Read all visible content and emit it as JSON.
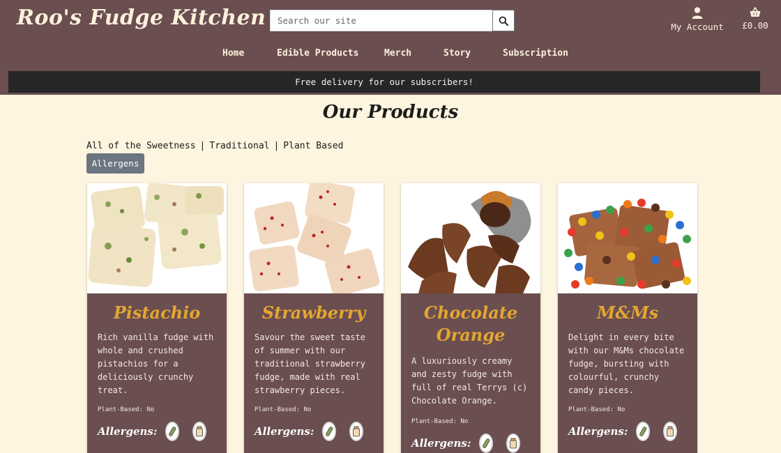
{
  "brand": {
    "logo_text": "Roo's Fudge Kitchen"
  },
  "search": {
    "placeholder": "Search our site",
    "value": ""
  },
  "header": {
    "account_label": "My Account",
    "cart_total": "£0.00"
  },
  "nav": {
    "items": [
      "Home",
      "Edible Products",
      "Merch",
      "Story",
      "Subscription"
    ]
  },
  "banner": {
    "text": "Free delivery for our subscribers!"
  },
  "page": {
    "title": "Our Products"
  },
  "filters": {
    "links": [
      "All of the Sweetness",
      "Traditional",
      "Plant Based"
    ],
    "separator": "|",
    "allergens_button": "Allergens"
  },
  "products": [
    {
      "name": "Pistachio",
      "description": "Rich vanilla fudge with whole and crushed pistachios for a deliciously crunchy treat.",
      "plant_based": "Plant-Based: No",
      "allergens_label": "Allergens:",
      "allergen_icons": [
        "nut-icon",
        "milk-icon"
      ]
    },
    {
      "name": "Strawberry",
      "description": "Savour the sweet taste of summer with our traditional strawberry fudge, made with real strawberry pieces.",
      "plant_based": "Plant-Based: No",
      "allergens_label": "Allergens:",
      "allergen_icons": [
        "nut-icon",
        "milk-icon"
      ]
    },
    {
      "name": "Chocolate Orange",
      "description": "A luxuriously creamy and zesty fudge with full of real Terrys (c) Chocolate Orange.",
      "plant_based": "Plant-Based: No",
      "allergens_label": "Allergens:",
      "allergen_icons": [
        "nut-icon",
        "milk-icon"
      ]
    },
    {
      "name": "M&Ms",
      "description": "Delight in every bite with our M&Ms chocolate fudge, bursting with colourful, crunchy candy pieces.",
      "plant_based": "Plant-Based: No",
      "allergens_label": "Allergens:",
      "allergen_icons": [
        "nut-icon",
        "milk-icon"
      ]
    }
  ],
  "colors": {
    "header_bg": "#6a4e50",
    "page_bg": "#fdf5df",
    "accent_gold": "#e3a630",
    "banner_bg": "#262626",
    "button_gray": "#6c7580"
  }
}
